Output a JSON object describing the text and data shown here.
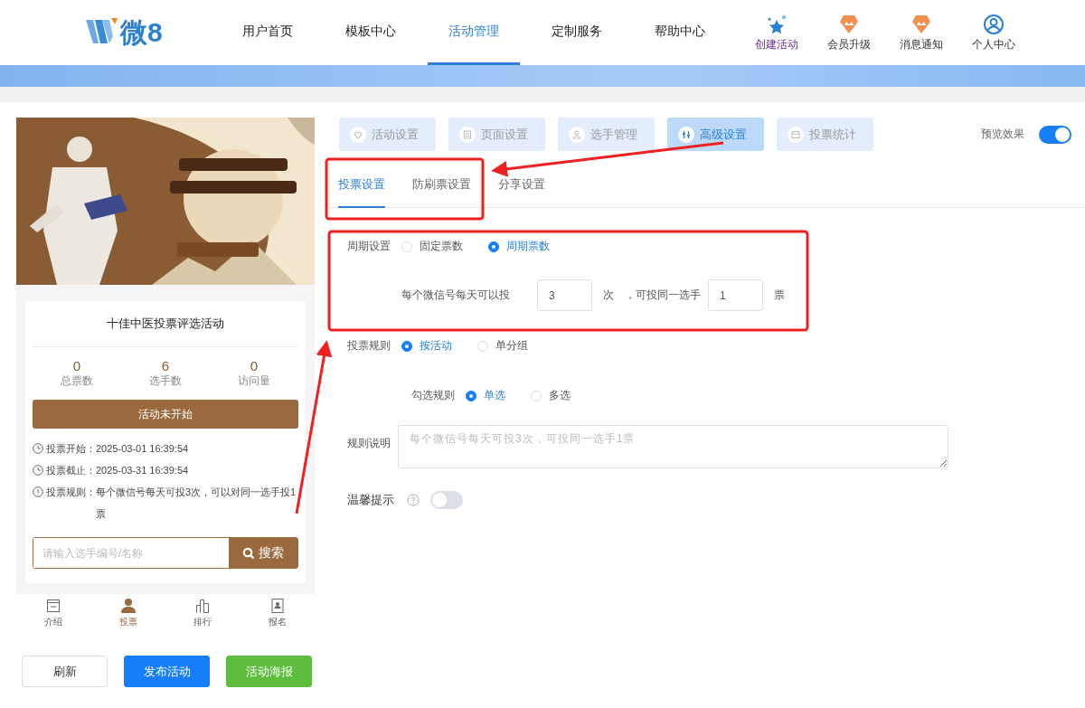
{
  "logo": {
    "text": "微8"
  },
  "nav": [
    {
      "label": "用户首页",
      "selected": false
    },
    {
      "label": "模板中心",
      "selected": false
    },
    {
      "label": "活动管理",
      "selected": true
    },
    {
      "label": "定制服务",
      "selected": false
    },
    {
      "label": "帮助中心",
      "selected": false
    }
  ],
  "header_actions": [
    {
      "label": "创建活动",
      "kind": "stars"
    },
    {
      "label": "会员升级",
      "kind": "badge"
    },
    {
      "label": "消息通知",
      "kind": "badge"
    },
    {
      "label": "个人中心",
      "kind": "user"
    }
  ],
  "preview": {
    "title": "十佳中医投票评选活动",
    "stats": [
      {
        "value": "0",
        "label": "总票数"
      },
      {
        "value": "6",
        "label": "选手数"
      },
      {
        "value": "0",
        "label": "访问量"
      }
    ],
    "status_button": "活动未开始",
    "info": [
      {
        "kind": "clock",
        "label": "投票开始：",
        "value": "2025-03-01 16:39:54"
      },
      {
        "kind": "clock",
        "label": "投票截止：",
        "value": "2025-03-31 16:39:54"
      },
      {
        "kind": "info",
        "label": "投票规则：",
        "value": "每个微信号每天可投3次，可以对同一选手投1票"
      }
    ],
    "search": {
      "placeholder": "请输入选手编号/名称",
      "button": "搜索"
    },
    "bottom_nav": [
      {
        "label": "介绍",
        "kind": "doc",
        "selected": false
      },
      {
        "label": "投票",
        "kind": "person",
        "selected": true
      },
      {
        "label": "排行",
        "kind": "bars",
        "selected": false
      },
      {
        "label": "报名",
        "kind": "card",
        "selected": false
      }
    ]
  },
  "actions": [
    {
      "label": "刷新",
      "kind": "default"
    },
    {
      "label": "发布活动",
      "kind": "primary"
    },
    {
      "label": "活动海报",
      "kind": "success"
    }
  ],
  "step_tabs": [
    {
      "label": "活动设置",
      "kind": "heart",
      "selected": false
    },
    {
      "label": "页面设置",
      "kind": "page",
      "selected": false
    },
    {
      "label": "选手管理",
      "kind": "person",
      "selected": false
    },
    {
      "label": "高级设置",
      "kind": "sliders",
      "selected": true
    },
    {
      "label": "投票统计",
      "kind": "chart",
      "selected": false
    }
  ],
  "preview_toggle": {
    "label": "预览效果",
    "on": true
  },
  "sub_tabs": [
    {
      "label": "投票设置",
      "selected": true
    },
    {
      "label": "防刷票设置",
      "selected": false
    },
    {
      "label": "分享设置",
      "selected": false
    }
  ],
  "form": {
    "period": {
      "label": "周期设置",
      "options": [
        {
          "label": "固定票数",
          "selected": false
        },
        {
          "label": "周期票数",
          "selected": true
        }
      ]
    },
    "daily": {
      "prefix": "每个微信号每天可以投",
      "times_value": "3",
      "times_unit": "次",
      "same_label": "，可投同一选手",
      "same_value": "1",
      "same_unit": "票"
    },
    "vote_rule": {
      "label": "投票规则",
      "options": [
        {
          "label": "按活动",
          "selected": true
        },
        {
          "label": "单分组",
          "selected": false
        }
      ]
    },
    "check_rule": {
      "label": "勾选规则",
      "options": [
        {
          "label": "单选",
          "selected": true
        },
        {
          "label": "多选",
          "selected": false
        }
      ]
    },
    "rule_desc": {
      "label": "规则说明",
      "placeholder": "每个微信号每天可投3次，可投同一选手1票"
    },
    "tip": {
      "label": "温馨提示",
      "on": false
    }
  }
}
